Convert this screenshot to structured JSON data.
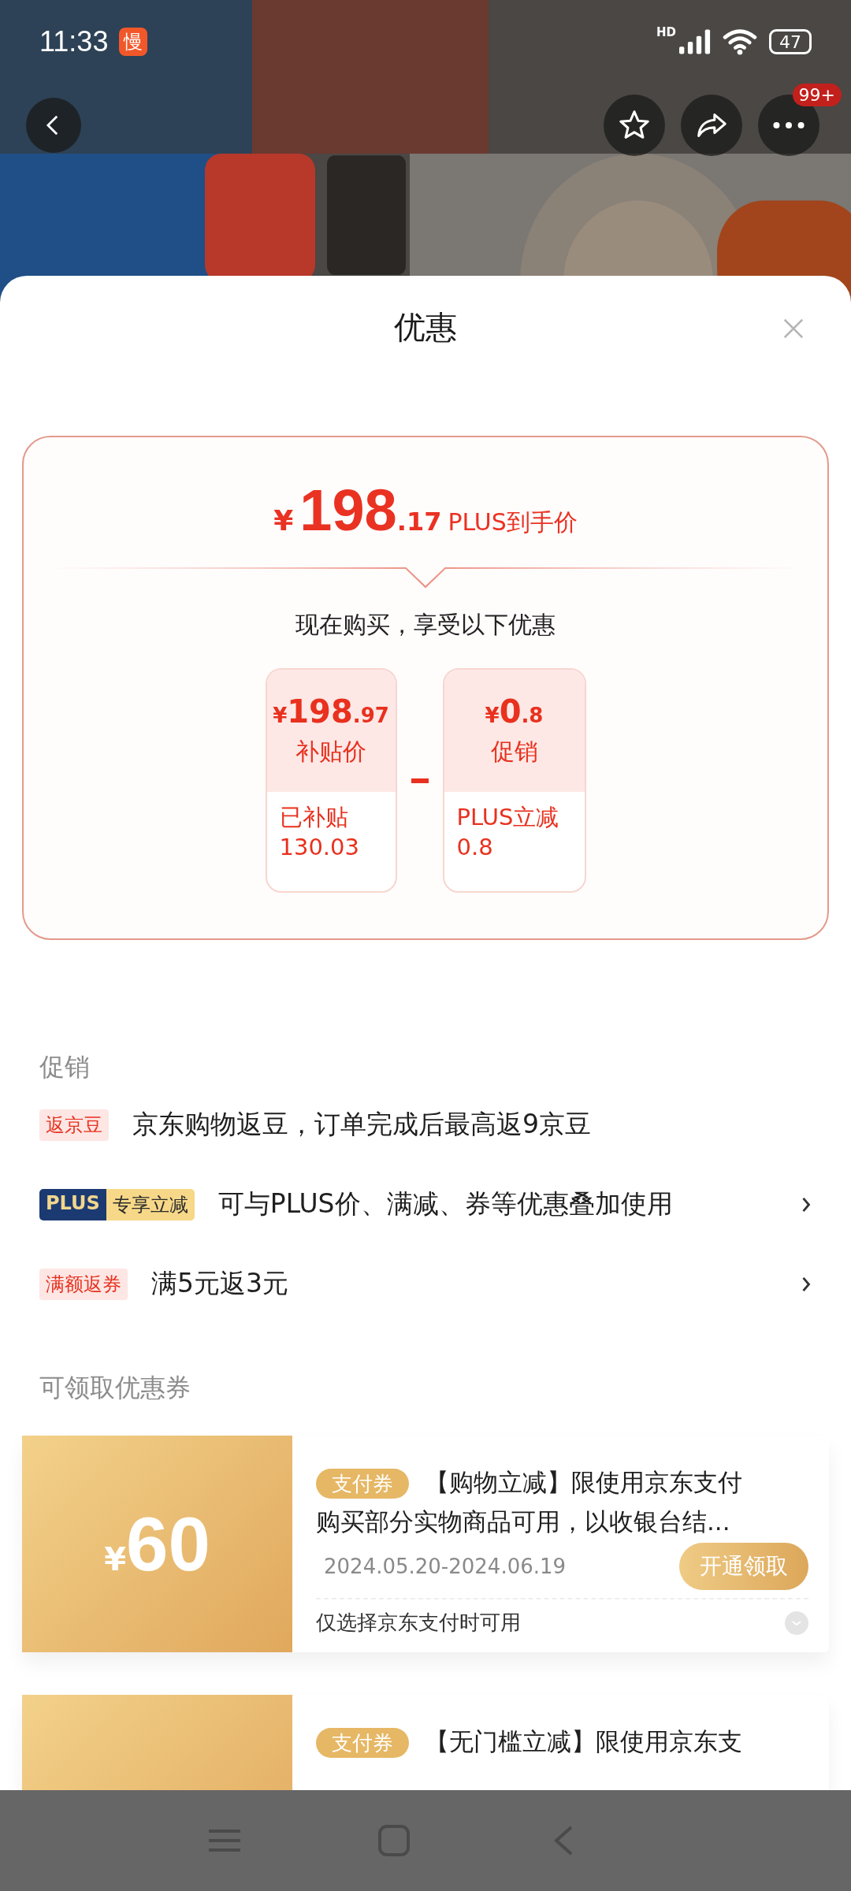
{
  "status_bar": {
    "time": "11:33",
    "app_badge": "慢",
    "network": "HD",
    "battery": "47"
  },
  "header": {
    "more_badge": "99+"
  },
  "sheet": {
    "title": "优惠"
  },
  "price_card": {
    "currency": "¥",
    "price_integer": "198",
    "price_decimal": ".17",
    "price_label": "PLUS到手价",
    "subtitle": "现在购买，享受以下优惠",
    "breakdown": [
      {
        "currency": "¥",
        "integer": "198",
        "decimal": ".97",
        "label": "补贴价",
        "detail": "已补贴 130.03"
      },
      {
        "currency": "¥",
        "integer": "0",
        "decimal": ".8",
        "label": "促销",
        "detail": "PLUS立减 0.8"
      }
    ]
  },
  "promotions": {
    "heading": "促销",
    "items": [
      {
        "kind": "tag",
        "tag": "返京豆",
        "text": "京东购物返豆，订单完成后最高返9京豆",
        "chevron": false
      },
      {
        "kind": "plus",
        "plus_label": "PLUS",
        "tag": "专享立减",
        "text": "可与PLUS价、满减、券等优惠叠加使用",
        "chevron": true
      },
      {
        "kind": "tag",
        "tag": "满额返券",
        "text": "满5元返3元",
        "chevron": true
      }
    ]
  },
  "coupons": {
    "heading": "可领取优惠券",
    "items": [
      {
        "currency": "¥",
        "amount": "60",
        "tag": "支付券",
        "title": "【购物立减】限使用京东支付购买部分实物商品可用，以收银台结...",
        "date": "2024.05.20-2024.06.19",
        "button": "开通领取",
        "note": "仅选择京东支付时可用"
      },
      {
        "tag": "支付券",
        "title": "【无门槛立减】限使用京东支"
      }
    ]
  }
}
